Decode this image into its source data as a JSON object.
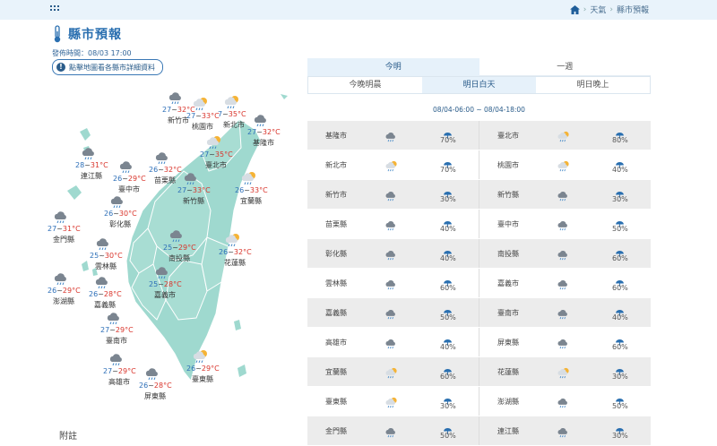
{
  "breadcrumb": {
    "home_icon": "home-icon",
    "items": [
      "天氣",
      "縣市預報"
    ]
  },
  "page": {
    "title": "縣市預報",
    "title_icon": "thermometer-icon",
    "issued": "發佈時間：08/03 17:00",
    "map_button": "點擊地圖看各縣市詳細資料",
    "footnote": "附註"
  },
  "map": {
    "land_color": "#9fd9cf",
    "items": [
      {
        "name": "新竹市",
        "temp_lo": "27",
        "temp_hi": "32°C",
        "wx": "cloud-rain"
      },
      {
        "name": "桃園市",
        "temp_lo": "27",
        "temp_hi": "33°C",
        "wx": "sun-cloud-rain"
      },
      {
        "name": "新北市",
        "temp_lo": "7",
        "temp_hi": "35°C",
        "wx": "sun-cloud-rain"
      },
      {
        "name": "基隆市",
        "temp_lo": "27",
        "temp_hi": "32°C",
        "wx": "cloud-rain"
      },
      {
        "name": "連江縣",
        "temp_lo": "28",
        "temp_hi": "31°C",
        "wx": "cloud-rain"
      },
      {
        "name": "臺中市",
        "temp_lo": "26",
        "temp_hi": "29°C",
        "wx": "cloud-rain"
      },
      {
        "name": "苗栗縣",
        "temp_lo": "26",
        "temp_hi": "32°C",
        "wx": "cloud-rain"
      },
      {
        "name": "臺北市",
        "temp_lo": "27",
        "temp_hi": "35°C",
        "wx": "sun-cloud-rain"
      },
      {
        "name": "新竹縣",
        "temp_lo": "27",
        "temp_hi": "33°C",
        "wx": "cloud-rain"
      },
      {
        "name": "宜蘭縣",
        "temp_lo": "26",
        "temp_hi": "33°C",
        "wx": "sun-cloud-rain"
      },
      {
        "name": "彰化縣",
        "temp_lo": "26",
        "temp_hi": "30°C",
        "wx": "cloud-rain"
      },
      {
        "name": "金門縣",
        "temp_lo": "27",
        "temp_hi": "31°C",
        "wx": "cloud-rain"
      },
      {
        "name": "南投縣",
        "temp_lo": "25",
        "temp_hi": "29°C",
        "wx": "cloud-rain"
      },
      {
        "name": "花蓮縣",
        "temp_lo": "26",
        "temp_hi": "32°C",
        "wx": "sun-cloud-rain"
      },
      {
        "name": "雲林縣",
        "temp_lo": "25",
        "temp_hi": "30°C",
        "wx": "cloud-rain"
      },
      {
        "name": "嘉義市",
        "temp_lo": "25",
        "temp_hi": "28°C",
        "wx": "cloud-rain"
      },
      {
        "name": "澎湖縣",
        "temp_lo": "26",
        "temp_hi": "29°C",
        "wx": "cloud-rain"
      },
      {
        "name": "嘉義縣",
        "temp_lo": "26",
        "temp_hi": "28°C",
        "wx": "cloud-rain"
      },
      {
        "name": "臺南市",
        "temp_lo": "27",
        "temp_hi": "29°C",
        "wx": "cloud-rain"
      },
      {
        "name": "高雄市",
        "temp_lo": "27",
        "temp_hi": "29°C",
        "wx": "cloud-rain"
      },
      {
        "name": "屏東縣",
        "temp_lo": "26",
        "temp_hi": "28°C",
        "wx": "cloud-rain"
      },
      {
        "name": "臺東縣",
        "temp_lo": "26",
        "temp_hi": "29°C",
        "wx": "sun-cloud-rain"
      }
    ]
  },
  "tabs_primary": [
    {
      "label": "今明",
      "active": true
    },
    {
      "label": "一週",
      "active": false
    }
  ],
  "tabs_secondary": [
    {
      "label": "今晚明晨",
      "active": false
    },
    {
      "label": "明日白天",
      "active": true
    },
    {
      "label": "明日晚上",
      "active": false
    }
  ],
  "period": "08/04-06:00 ~ 08/04-18:00",
  "table": {
    "rows": [
      {
        "left": {
          "name": "基隆市",
          "wx": "cloud-rain",
          "pop": "70%"
        },
        "right": {
          "name": "臺北市",
          "wx": "sun-cloud-rain",
          "pop": "80%"
        }
      },
      {
        "left": {
          "name": "新北市",
          "wx": "sun-cloud-rain",
          "pop": "70%"
        },
        "right": {
          "name": "桃園市",
          "wx": "sun-cloud-rain",
          "pop": "40%"
        }
      },
      {
        "left": {
          "name": "新竹市",
          "wx": "cloud-rain",
          "pop": "30%"
        },
        "right": {
          "name": "新竹縣",
          "wx": "cloud-rain",
          "pop": "30%"
        }
      },
      {
        "left": {
          "name": "苗栗縣",
          "wx": "cloud-rain",
          "pop": "40%"
        },
        "right": {
          "name": "臺中市",
          "wx": "cloud-rain",
          "pop": "50%"
        }
      },
      {
        "left": {
          "name": "彰化縣",
          "wx": "cloud-rain",
          "pop": "40%"
        },
        "right": {
          "name": "南投縣",
          "wx": "cloud-rain",
          "pop": "60%"
        }
      },
      {
        "left": {
          "name": "雲林縣",
          "wx": "cloud-rain",
          "pop": "60%"
        },
        "right": {
          "name": "嘉義市",
          "wx": "cloud-rain",
          "pop": "60%"
        }
      },
      {
        "left": {
          "name": "嘉義縣",
          "wx": "cloud-rain",
          "pop": "50%"
        },
        "right": {
          "name": "臺南市",
          "wx": "cloud-rain",
          "pop": "40%"
        }
      },
      {
        "left": {
          "name": "高雄市",
          "wx": "cloud-rain",
          "pop": "40%"
        },
        "right": {
          "name": "屏東縣",
          "wx": "cloud-rain",
          "pop": "60%"
        }
      },
      {
        "left": {
          "name": "宜蘭縣",
          "wx": "sun-cloud-rain",
          "pop": "60%"
        },
        "right": {
          "name": "花蓮縣",
          "wx": "sun-cloud-rain",
          "pop": "30%"
        }
      },
      {
        "left": {
          "name": "臺東縣",
          "wx": "sun-cloud-rain",
          "pop": "30%"
        },
        "right": {
          "name": "澎湖縣",
          "wx": "cloud-rain",
          "pop": "50%"
        }
      },
      {
        "left": {
          "name": "金門縣",
          "wx": "cloud-rain",
          "pop": "50%"
        },
        "right": {
          "name": "連江縣",
          "wx": "cloud-rain",
          "pop": "30%"
        }
      }
    ]
  },
  "colors": {
    "accent": "#2a6fb0",
    "temp_low": "#2d6fb8",
    "temp_high": "#d9342b",
    "row_alt": "#ececec"
  }
}
